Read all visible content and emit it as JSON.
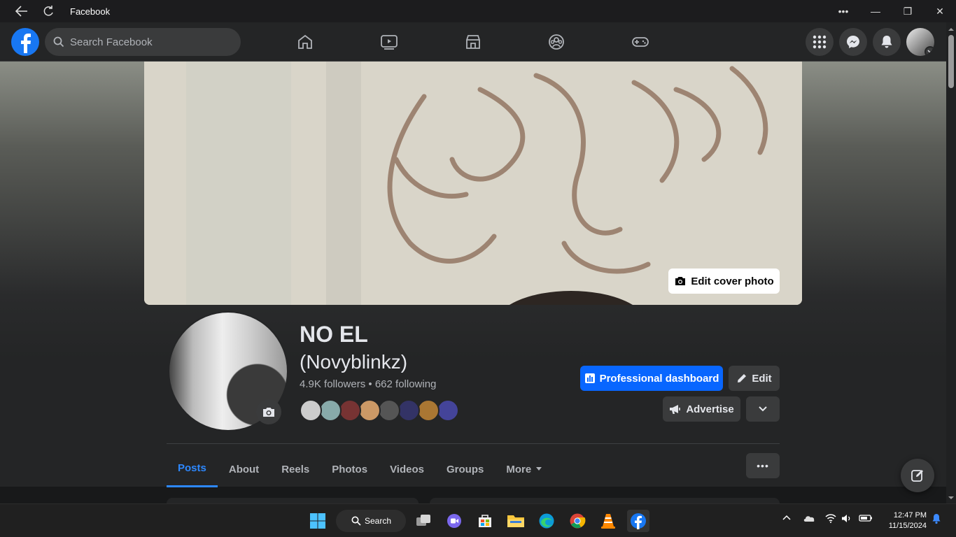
{
  "window": {
    "title": "Facebook"
  },
  "header": {
    "search_placeholder": "Search Facebook"
  },
  "cover": {
    "edit_label": "Edit cover photo"
  },
  "profile": {
    "name": "NO EL",
    "alternate_name": "(Novyblinkz)",
    "followers": "4.9K followers",
    "separator": "•",
    "following": "662 following"
  },
  "actions": {
    "dashboard_label": "Professional dashboard",
    "edit_label": "Edit",
    "advertise_label": "Advertise"
  },
  "tabs": [
    {
      "label": "Posts"
    },
    {
      "label": "About"
    },
    {
      "label": "Reels"
    },
    {
      "label": "Photos"
    },
    {
      "label": "Videos"
    },
    {
      "label": "Groups"
    },
    {
      "label": "More"
    }
  ],
  "friend_avatar_colors": [
    "#ccc",
    "#8aa",
    "#733",
    "#c96",
    "#555",
    "#336",
    "#a73",
    "#449"
  ],
  "taskbar": {
    "search_label": "Search",
    "time": "12:47 PM",
    "date": "11/15/2024"
  },
  "colors": {
    "accent": "#0866ff",
    "active_tab": "#2d88ff",
    "background": "#18191a"
  }
}
